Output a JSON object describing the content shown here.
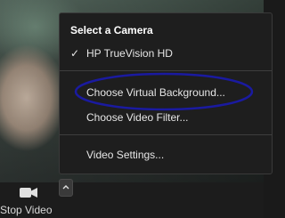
{
  "menu": {
    "header": "Select a Camera",
    "camera": {
      "check": "✓",
      "label": "HP TrueVision HD"
    },
    "items": [
      {
        "label": "Choose Virtual Background..."
      },
      {
        "label": "Choose Video Filter..."
      },
      {
        "label": "Video Settings..."
      }
    ]
  },
  "toolbar": {
    "stop_video_label": "Stop Video",
    "camera_icon": "video-camera-icon",
    "caret_icon": "chevron-up-icon"
  },
  "annotation": {
    "color": "#1a1aa0"
  }
}
